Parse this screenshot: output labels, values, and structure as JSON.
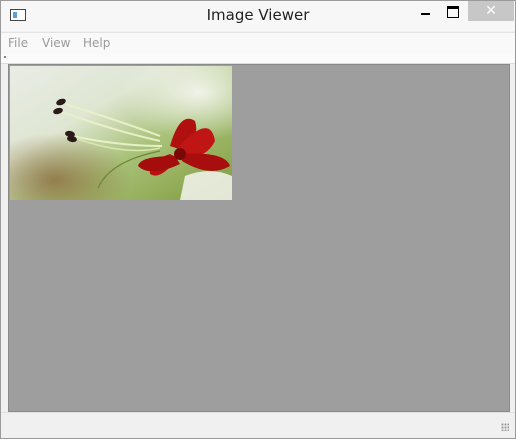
{
  "window": {
    "title": "Image Viewer",
    "icon": "app-window-icon",
    "close_glyph": "✕"
  },
  "menubar": {
    "items": [
      "File",
      "View",
      "Help"
    ]
  },
  "image": {
    "subject": "red lily flower with stamens",
    "icon": "image"
  },
  "colors": {
    "viewport_bg": "#9e9e9e",
    "titlebar_bg": "#f7f7f7",
    "close_bg": "#c7c7c7"
  }
}
